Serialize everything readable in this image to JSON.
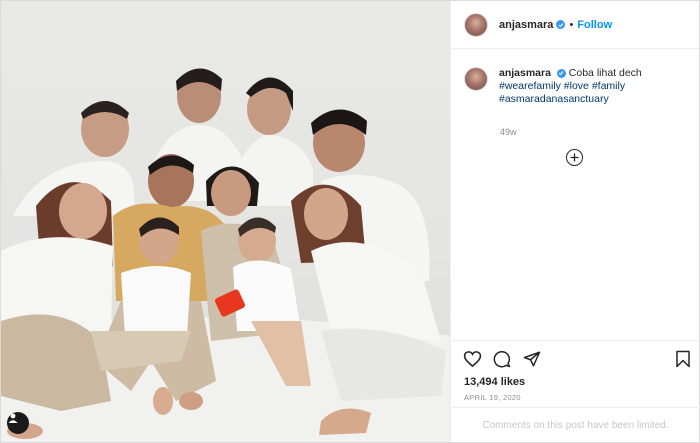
{
  "header": {
    "username": "anjasmara",
    "separator": "•",
    "follow_label": "Follow"
  },
  "caption": {
    "username": "anjasmara",
    "text": "Coba lihat dech",
    "hashtags": [
      "#wearefamily",
      "#love",
      "#family",
      "#asmaradanasanctuary"
    ],
    "age": "49w"
  },
  "stats": {
    "likes": "13,494 likes",
    "date": "APRIL 19, 2020"
  },
  "comments_notice": "Comments on this post have been limited.",
  "icons": {
    "verified": "verified-badge-icon",
    "like": "heart-icon",
    "comment": "comment-icon",
    "share": "share-icon",
    "save": "bookmark-icon",
    "load_more": "plus-circle-icon",
    "photo_tags": "user-icon"
  },
  "colors": {
    "accent": "#0095f6",
    "verified": "#3897f0",
    "hashtag": "#00376b",
    "muted": "#8e8e8e"
  }
}
